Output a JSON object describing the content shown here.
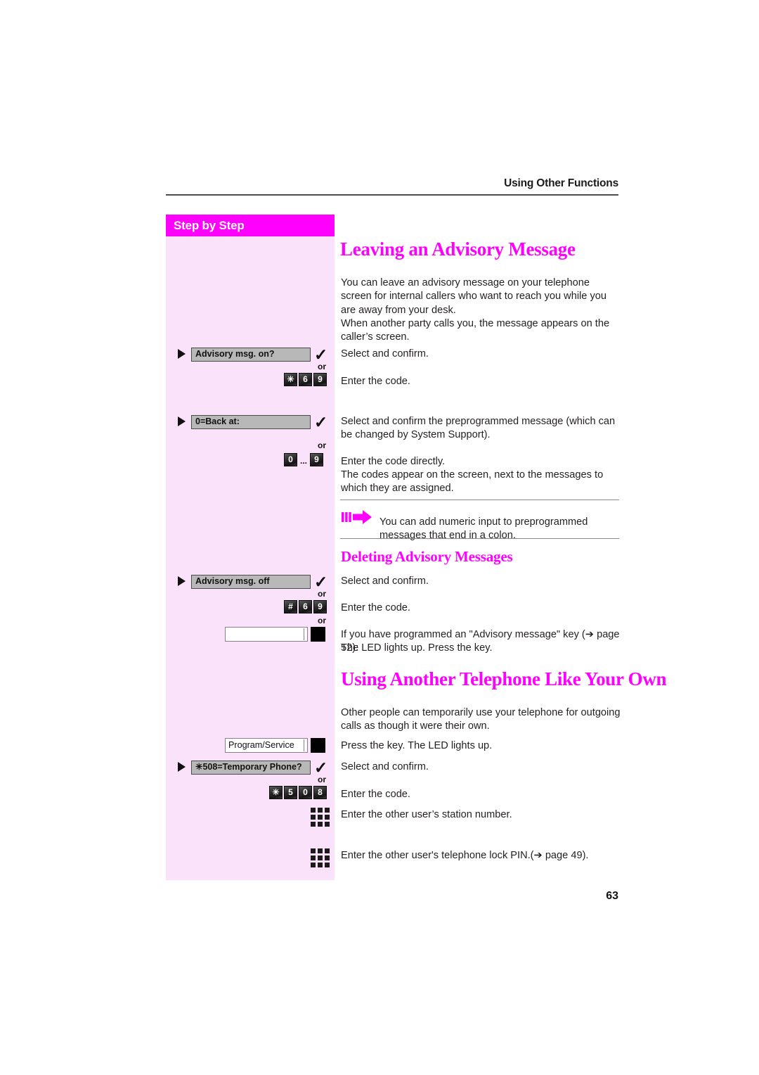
{
  "page": {
    "running_head": "Using Other Functions",
    "number": "63"
  },
  "sidebar": {
    "header_label": "Step by Step",
    "bg_color": "#fbe2fb",
    "header_color": "#ff00ff"
  },
  "sections": {
    "advisory": {
      "title": "Leaving an Advisory Message",
      "intro_1": "You can leave an advisory message on your telephone screen for internal callers who want to reach you while you are away from your desk.",
      "intro_2": "When another party calls you, the message appears on the caller’s screen.",
      "step1": {
        "option_label": "Advisory msg. on?",
        "confirm_glyph": "✓",
        "or": "or",
        "keys": [
          "✳",
          "6",
          "9"
        ],
        "desc_select": "Select and confirm.",
        "desc_code": "Enter the code."
      },
      "step2": {
        "option_label": "0=Back at:",
        "confirm_glyph": "✓",
        "or": "or",
        "keys": [
          "0",
          "...",
          "9"
        ],
        "desc_select": "Select and confirm the preprogrammed message (which can be changed by System Support).",
        "desc_code_1": "Enter the code directly.",
        "desc_code_2": "The codes appear on the screen, next to the messages to which they are assigned."
      },
      "note": {
        "text": "You can add numeric input to preprogrammed messages that end in a colon.",
        "arrow_color": "#ff00ff"
      }
    },
    "deleting": {
      "title": "Deleting Advisory Messages",
      "option_label": "Advisory msg. off",
      "confirm_glyph": "✓",
      "or_1": "or",
      "or_2": "or",
      "keys": [
        "#",
        "6",
        "9"
      ],
      "desc_select": "Select and confirm.",
      "desc_code": "Enter the code.",
      "desc_key_1": "If you have programmed an \"Advisory message\" key (➔ page 52):",
      "desc_key_2": "The LED lights up. Press the key.",
      "blank_key_label": ""
    },
    "another_phone": {
      "title": "Using Another Telephone Like Your Own",
      "intro": "Other people can temporarily use your telephone for outgoing calls as though it were their own.",
      "program_key_label": "Program/Service",
      "desc_press_key": "Press the key. The LED lights up.",
      "option_label": "✳508=Temporary Phone?",
      "confirm_glyph": "✓",
      "or": "or",
      "keys": [
        "✳",
        "5",
        "0",
        "8"
      ],
      "desc_select": "Select and confirm.",
      "desc_code": "Enter the code.",
      "desc_station": "Enter the other user’s station number.",
      "desc_pin": "Enter the other user's telephone lock PIN.(➔ page 49)."
    }
  }
}
